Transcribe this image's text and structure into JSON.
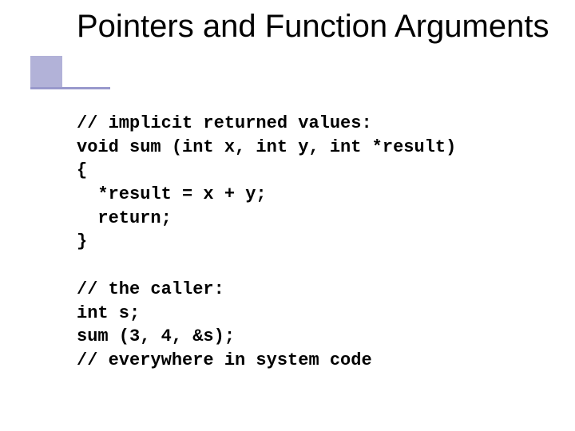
{
  "title": "Pointers and Function\nArguments",
  "code": "// implicit returned values:\nvoid sum (int x, int y, int *result)\n{\n  *result = x + y;\n  return;\n}\n\n// the caller:\nint s;\nsum (3, 4, &s);\n// everywhere in system code"
}
